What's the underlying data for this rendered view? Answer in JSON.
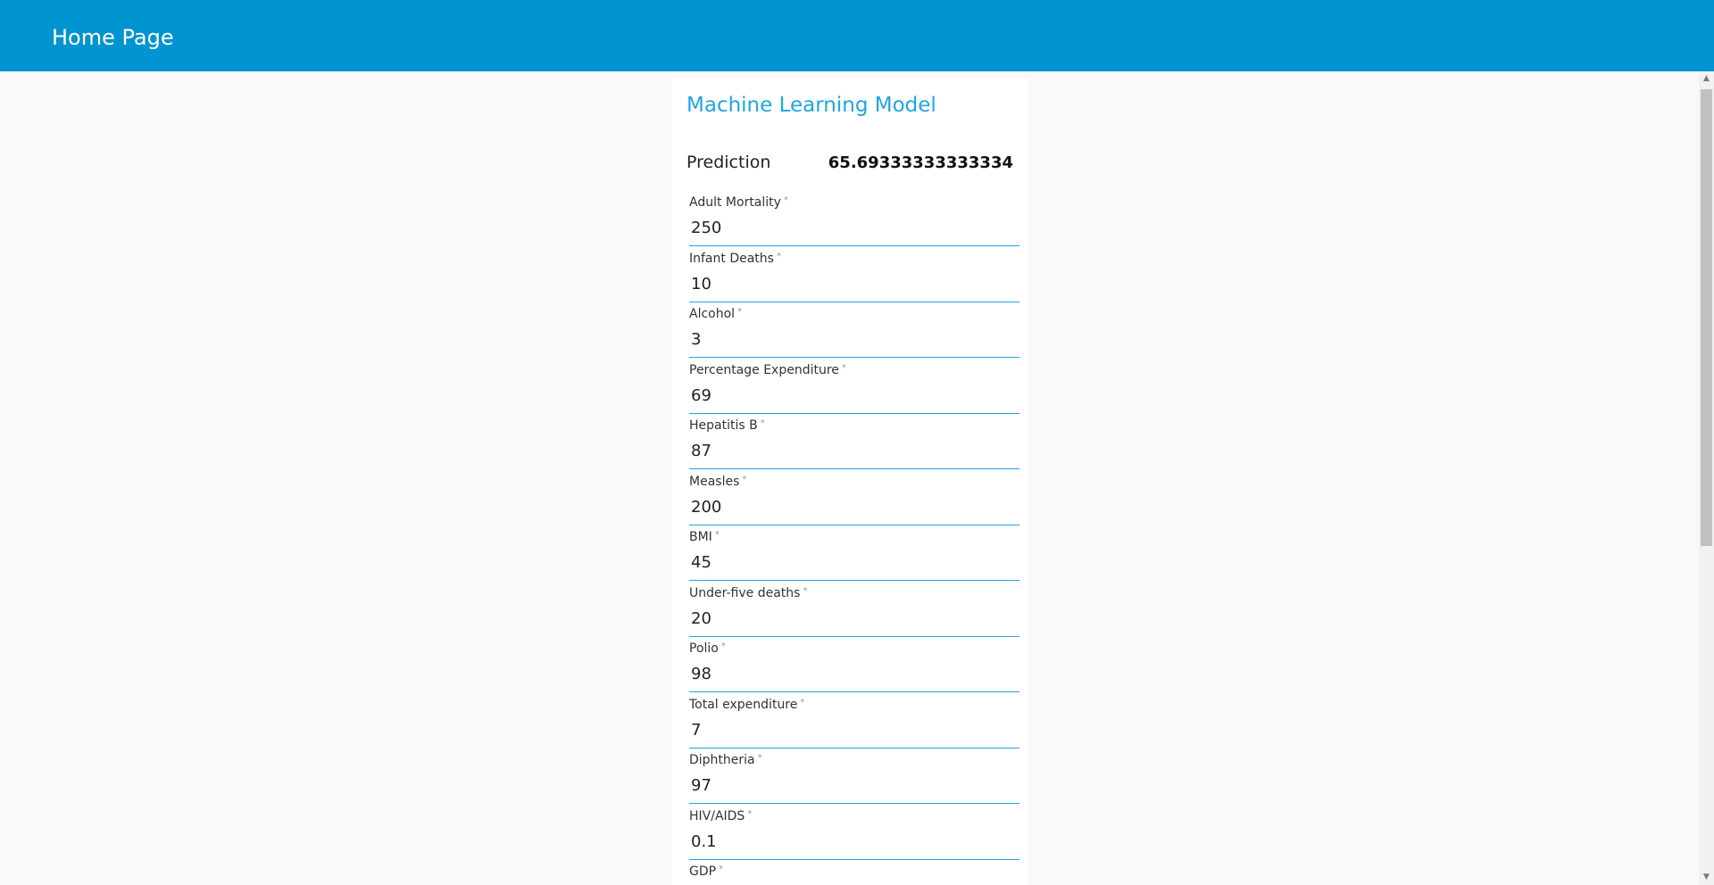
{
  "header": {
    "title": "Home Page"
  },
  "card": {
    "title": "Machine Learning Model",
    "prediction_label": "Prediction",
    "prediction_value": "65.69333333333334",
    "required_marker": "*"
  },
  "fields": [
    {
      "label": "Adult Mortality",
      "value": "250"
    },
    {
      "label": "Infant Deaths",
      "value": "10"
    },
    {
      "label": "Alcohol",
      "value": "3"
    },
    {
      "label": "Percentage Expenditure",
      "value": "69"
    },
    {
      "label": "Hepatitis B",
      "value": "87"
    },
    {
      "label": "Measles",
      "value": "200"
    },
    {
      "label": "BMI",
      "value": "45"
    },
    {
      "label": "Under-five deaths",
      "value": "20"
    },
    {
      "label": "Polio",
      "value": "98"
    },
    {
      "label": "Total expenditure",
      "value": "7"
    },
    {
      "label": "Diphtheria",
      "value": "97"
    },
    {
      "label": "HIV/AIDS",
      "value": "0.1"
    },
    {
      "label": "GDP",
      "value": ""
    }
  ],
  "scrollbar": {
    "up_icon": "▲",
    "down_icon": "▼"
  },
  "colors": {
    "header_bg": "#0094d0",
    "accent": "#1fa5e6",
    "page_bg": "#f9f9f9"
  }
}
